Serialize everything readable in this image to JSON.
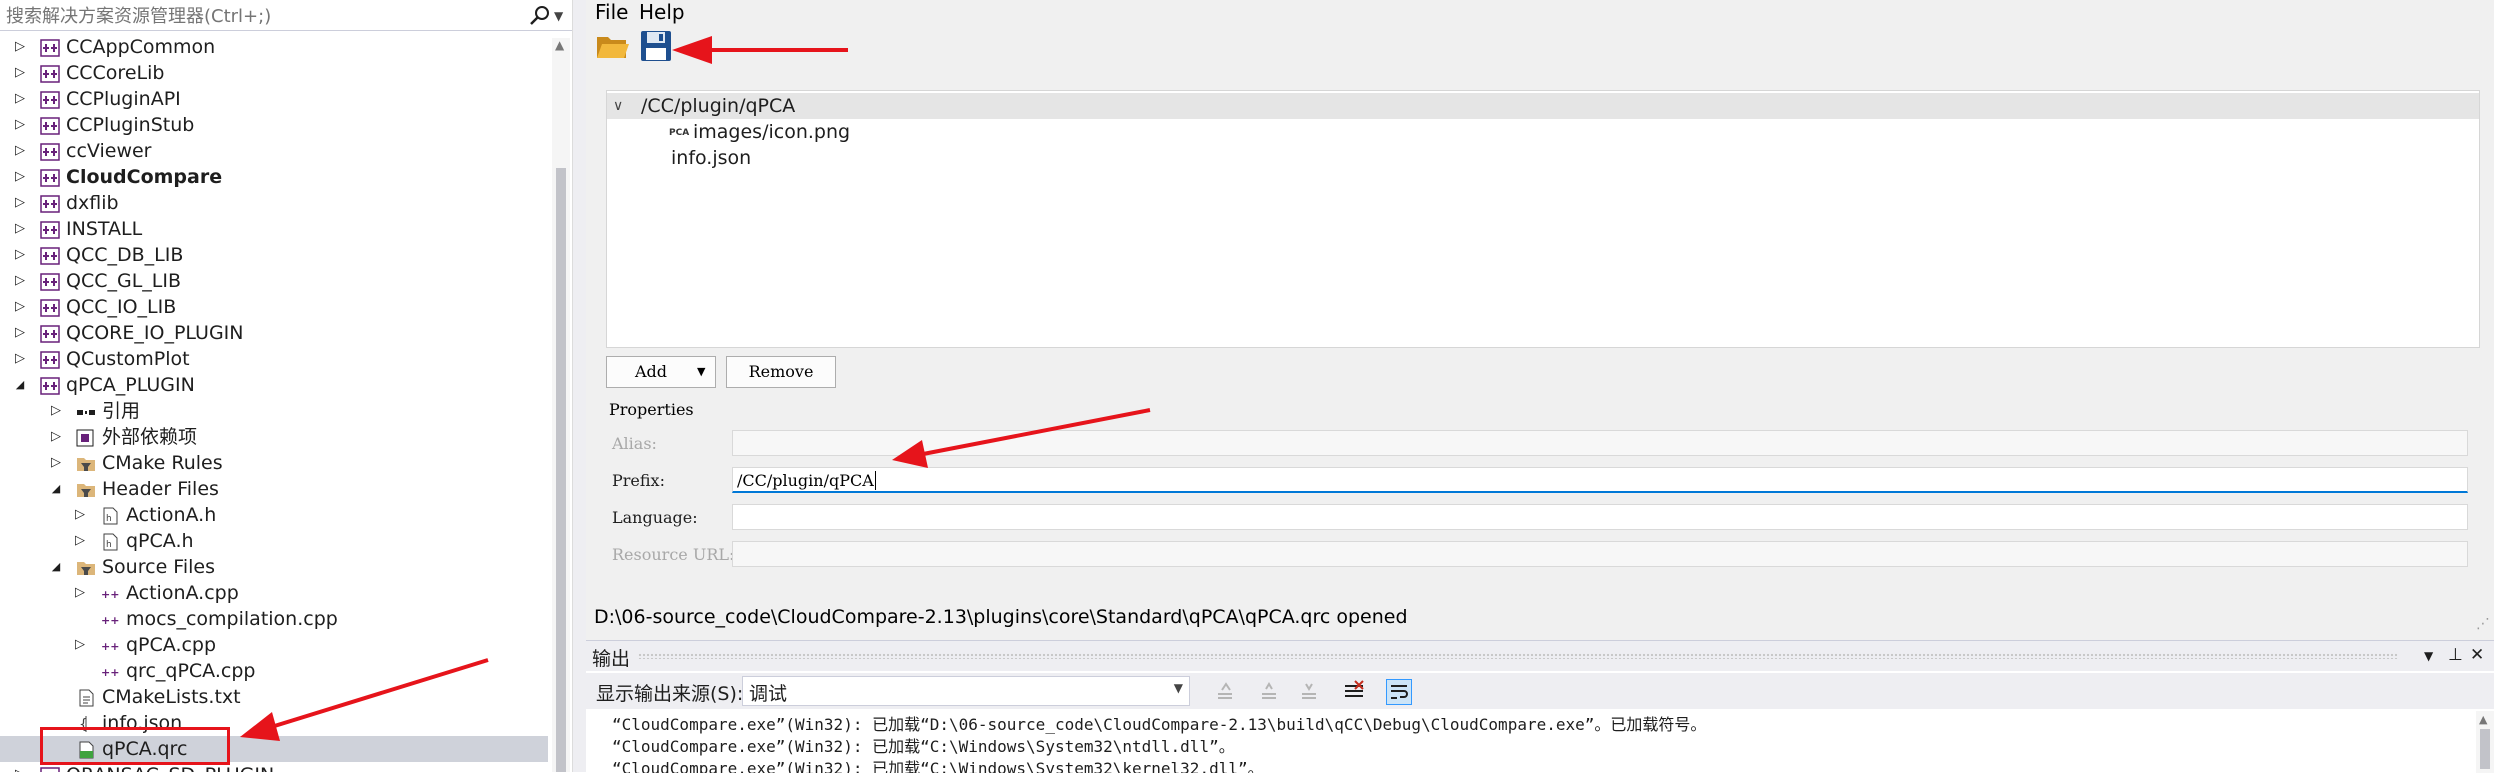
{
  "solution_explorer": {
    "search_placeholder": "搜索解决方案资源管理器(Ctrl+;)",
    "items": [
      {
        "label": "CCAppCommon"
      },
      {
        "label": "CCCoreLib"
      },
      {
        "label": "CCPluginAPI"
      },
      {
        "label": "CCPluginStub"
      },
      {
        "label": "ccViewer"
      },
      {
        "label": "CloudCompare"
      },
      {
        "label": "dxflib"
      },
      {
        "label": "INSTALL"
      },
      {
        "label": "QCC_DB_LIB"
      },
      {
        "label": "QCC_GL_LIB"
      },
      {
        "label": "QCC_IO_LIB"
      },
      {
        "label": "QCORE_IO_PLUGIN"
      },
      {
        "label": "QCustomPlot"
      },
      {
        "label": "qPCA_PLUGIN"
      },
      {
        "label": "引用"
      },
      {
        "label": "外部依赖项"
      },
      {
        "label": "CMake Rules"
      },
      {
        "label": "Header Files"
      },
      {
        "label": "ActionA.h"
      },
      {
        "label": "qPCA.h"
      },
      {
        "label": "Source Files"
      },
      {
        "label": "ActionA.cpp"
      },
      {
        "label": "mocs_compilation.cpp"
      },
      {
        "label": "qPCA.cpp"
      },
      {
        "label": "qrc_qPCA.cpp"
      },
      {
        "label": "CMakeLists.txt"
      },
      {
        "label": "info.json"
      },
      {
        "label": "qPCA.qrc"
      },
      {
        "label": "QRANSAC_SD_PLUGIN"
      }
    ]
  },
  "editor": {
    "menu": {
      "file": "File",
      "help": "Help"
    },
    "toolbar": {
      "open_icon": "folder-open-icon",
      "save_icon": "floppy-disk-icon"
    },
    "tree": {
      "prefix": "/CC/plugin/qPCA",
      "files": [
        {
          "label": "images/icon.png",
          "badge": "PCA"
        },
        {
          "label": "info.json"
        }
      ]
    },
    "buttons": {
      "add": "Add",
      "remove": "Remove"
    },
    "properties": {
      "title": "Properties",
      "alias_label": "Alias:",
      "alias_value": "",
      "prefix_label": "Prefix:",
      "prefix_value": "/CC/plugin/qPCA",
      "language_label": "Language:",
      "language_value": "",
      "resource_url_label": "Resource URL:",
      "resource_url_value": ""
    },
    "status": "D:\\06-source_code\\CloudCompare-2.13\\plugins\\core\\Standard\\qPCA\\qPCA.qrc opened"
  },
  "output": {
    "title": "输出",
    "source_label": "显示输出来源(S):",
    "source_value": "调试",
    "lines": [
      "“CloudCompare.exe”(Win32): 已加载“D:\\06-source_code\\CloudCompare-2.13\\build\\qCC\\Debug\\CloudCompare.exe”。已加载符号。",
      "“CloudCompare.exe”(Win32): 已加载“C:\\Windows\\System32\\ntdll.dll”。",
      "“CloudCompare.exe”(Win32): 已加载“C:\\Windows\\System32\\kernel32.dll”。"
    ]
  },
  "colors": {
    "annotation_red": "#e6141b",
    "selection": "#cfd2da",
    "focus_blue": "#0078d7",
    "project_purple": "#68217a"
  }
}
